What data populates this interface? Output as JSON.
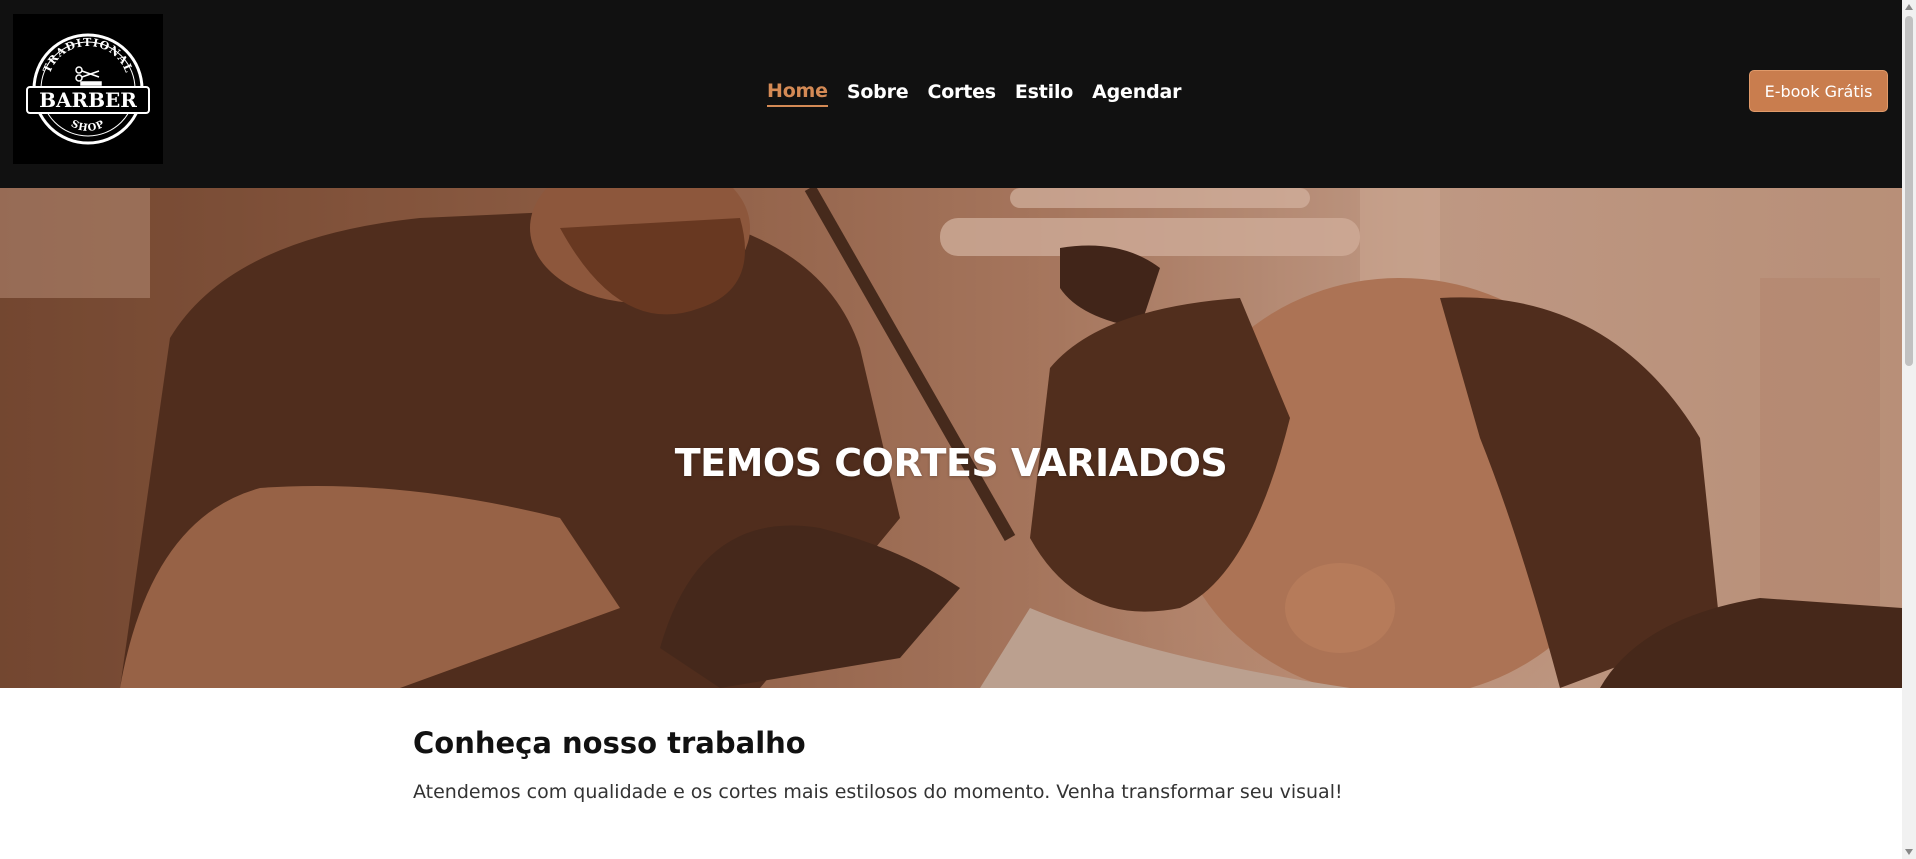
{
  "logo": {
    "top_text": "TRADITIONAL",
    "main_text": "BARBER",
    "bottom_text": "SHOP"
  },
  "nav": {
    "items": [
      {
        "label": "Home",
        "active": true
      },
      {
        "label": "Sobre",
        "active": false
      },
      {
        "label": "Cortes",
        "active": false
      },
      {
        "label": "Estilo",
        "active": false
      },
      {
        "label": "Agendar",
        "active": false
      }
    ]
  },
  "cta": {
    "ebook_label": "E-book Grátis"
  },
  "hero": {
    "title": "TEMOS CORTES VARIADOS"
  },
  "section": {
    "title": "Conheça nosso trabalho",
    "text": "Atendemos com qualidade e os cortes mais estilosos do momento. Venha transformar seu visual!"
  },
  "colors": {
    "header_bg": "#111111",
    "accent": "#d48a55",
    "button_bg": "#c97d4e"
  }
}
